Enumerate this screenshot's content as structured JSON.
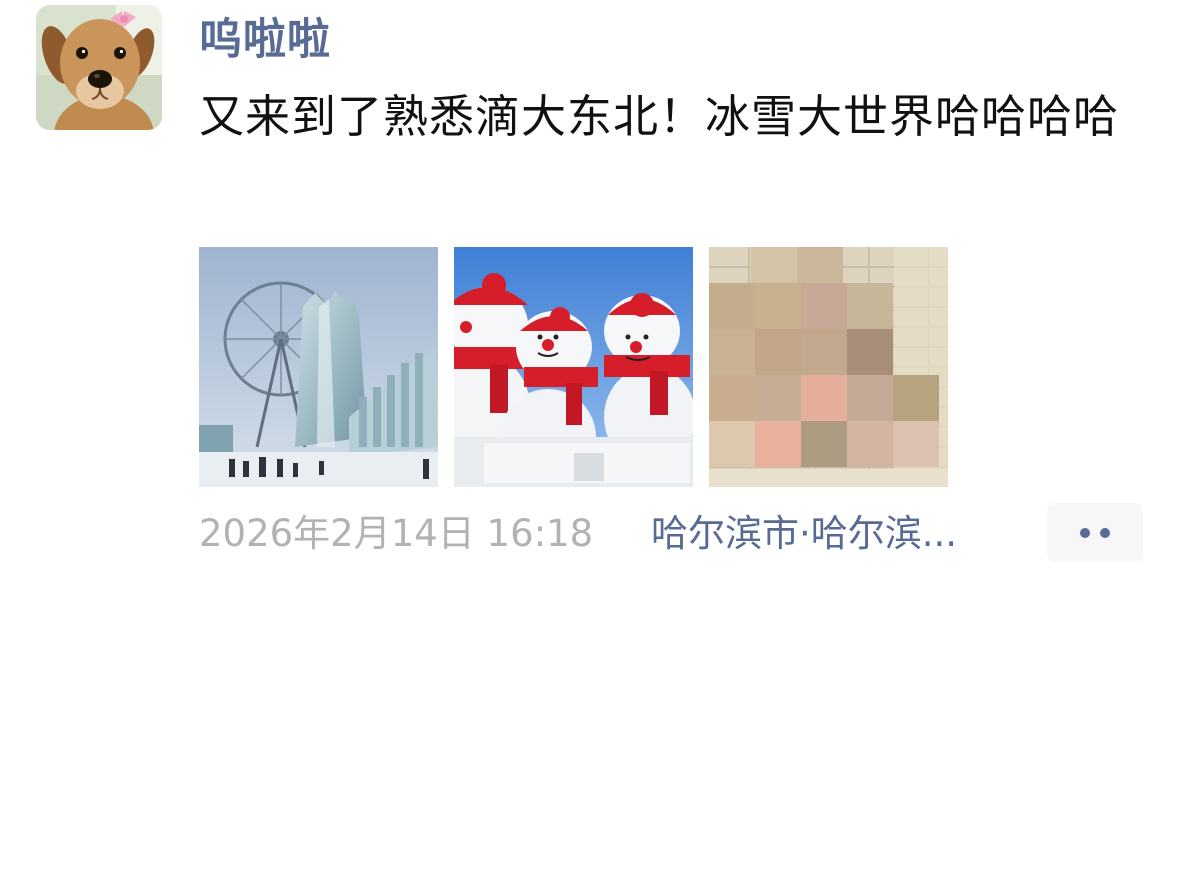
{
  "post": {
    "nickname": "呜啦啦",
    "text": "又来到了熟悉滴大东北！冰雪大世界哈哈哈哈",
    "photos": [
      {
        "icon": "ice-sculpture-photo"
      },
      {
        "icon": "snowmen-photo"
      },
      {
        "icon": "pixelated-photo"
      }
    ],
    "timestamp": "2026年2月14日 16:18",
    "location": "哈尔滨市·哈尔滨...",
    "more_button": {
      "label": "••",
      "icon": "more-dots-icon"
    }
  },
  "avatar": {
    "icon": "puppy-avatar"
  },
  "colors": {
    "link": "#576b95",
    "text": "#111111",
    "muted": "#b2b2b2",
    "button_bg": "#f7f7f7"
  }
}
